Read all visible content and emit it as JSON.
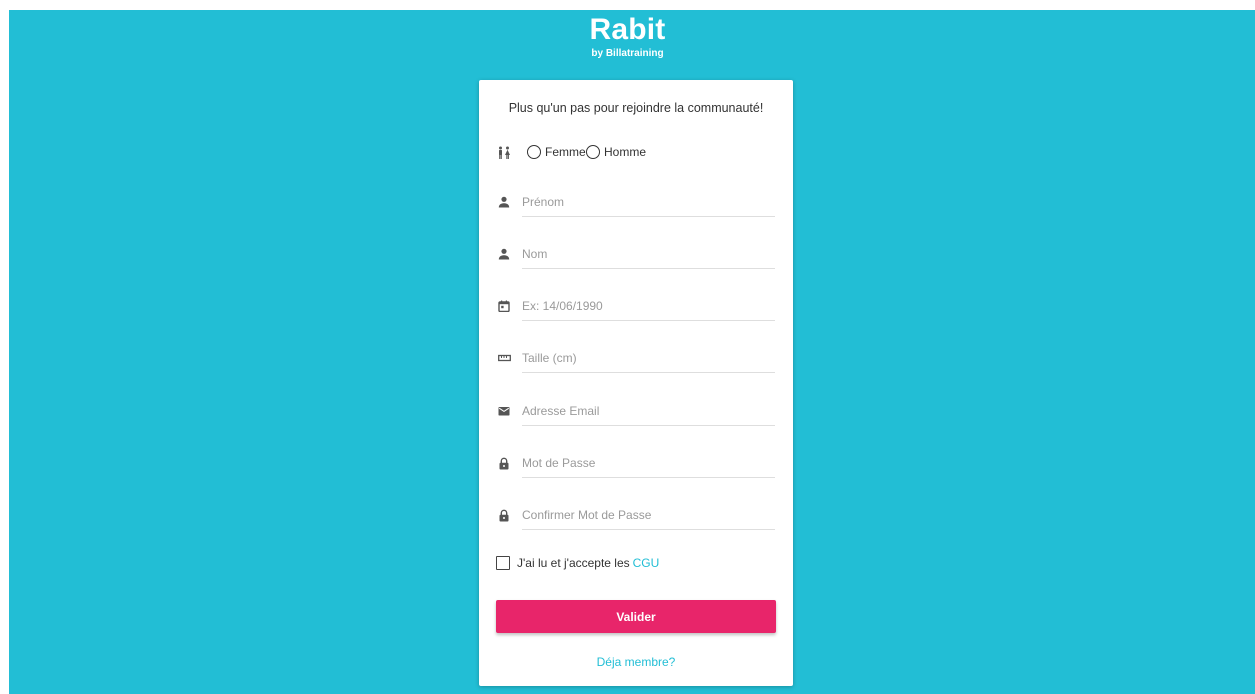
{
  "brand": {
    "name": "Rabit",
    "subtitle": "by Billatraining"
  },
  "colors": {
    "background": "#22bed5",
    "accent": "#22bed5",
    "button": "#e8256a"
  },
  "form": {
    "title": "Plus qu'un pas pour rejoindre la communauté!",
    "gender": {
      "icon": "wc-icon",
      "options": [
        "Femme",
        "Homme"
      ]
    },
    "fields": {
      "first_name": {
        "icon": "person-icon",
        "placeholder": "Prénom",
        "value": ""
      },
      "last_name": {
        "icon": "person-icon",
        "placeholder": "Nom",
        "value": ""
      },
      "birth_date": {
        "icon": "calendar-icon",
        "placeholder": "Ex: 14/06/1990",
        "value": ""
      },
      "height": {
        "icon": "ruler-icon",
        "placeholder": "Taille (cm)",
        "value": ""
      },
      "email": {
        "icon": "mail-icon",
        "placeholder": "Adresse Email",
        "value": ""
      },
      "password": {
        "icon": "lock-icon",
        "placeholder": "Mot de Passe",
        "value": ""
      },
      "password_confirm": {
        "icon": "lock-icon",
        "placeholder": "Confirmer Mot de Passe",
        "value": ""
      }
    },
    "cgu": {
      "text": "J'ai lu et j'accepte les",
      "link": "CGU",
      "checked": false
    },
    "submit_label": "Valider",
    "member_link": "Déja membre?"
  }
}
